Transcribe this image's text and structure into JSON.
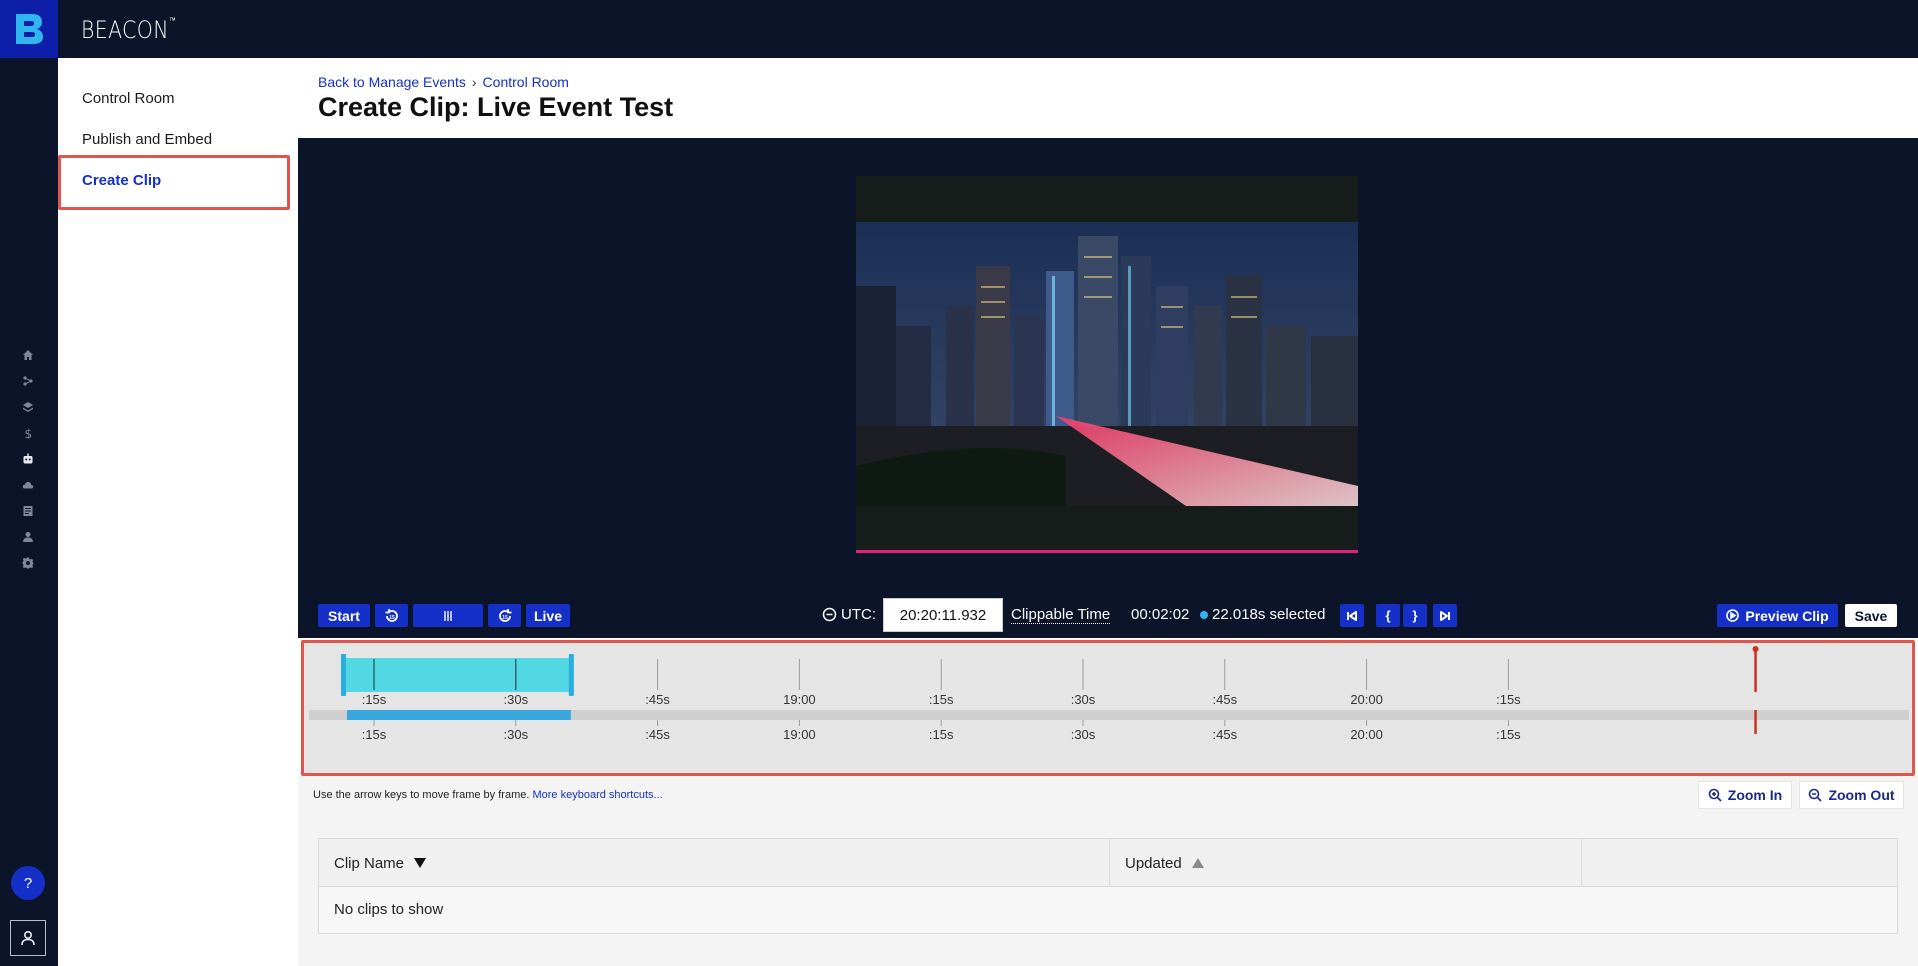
{
  "app": {
    "brand": "BEACON",
    "brand_mark": "™"
  },
  "rail": {
    "icons": [
      "home-icon",
      "share-icon",
      "layers-icon",
      "dollar-icon",
      "robot-icon",
      "cloud-icon",
      "document-icon",
      "user-icon",
      "gear-icon"
    ],
    "help_label": "?"
  },
  "sidenav": {
    "items": [
      {
        "label": "Control Room"
      },
      {
        "label": "Publish and Embed"
      },
      {
        "label": "Create Clip",
        "active": true
      }
    ]
  },
  "breadcrumb": {
    "back": "Back to Manage Events",
    "separator": "›",
    "current": "Control Room"
  },
  "page": {
    "title": "Create Clip: Live Event Test"
  },
  "controls": {
    "start_label": "Start",
    "rewind_label": "15",
    "forward_label": "15",
    "live_label": "Live",
    "utc_label": "UTC:",
    "utc_value": "20:20:11.932",
    "clippable_label": "Clippable Time",
    "duration": "00:02:02",
    "selected": "22.018s selected",
    "set_in_label": "{",
    "set_out_label": "}",
    "preview_label": "Preview Clip",
    "save_label": "Save"
  },
  "timeline": {
    "ticks": [
      ":15s",
      ":30s",
      ":45s",
      "19:00",
      ":15s",
      ":30s",
      ":45s",
      "20:00",
      ":15s"
    ],
    "selection_start": 0.0,
    "selection_end": 0.148,
    "playhead_fraction": 0.925
  },
  "hint": {
    "text": "Use the arrow keys to move frame by frame.",
    "link": "More keyboard shortcuts..."
  },
  "zoom": {
    "in_label": "Zoom In",
    "out_label": "Zoom Out"
  },
  "clips_table": {
    "columns": [
      "Clip Name",
      "Updated"
    ],
    "empty_message": "No clips to show"
  },
  "colors": {
    "accent": "#1530c9",
    "navy": "#0b1428",
    "highlight_border": "#e2554f",
    "selection": "#52d8e2",
    "playhead": "#c8321e"
  }
}
